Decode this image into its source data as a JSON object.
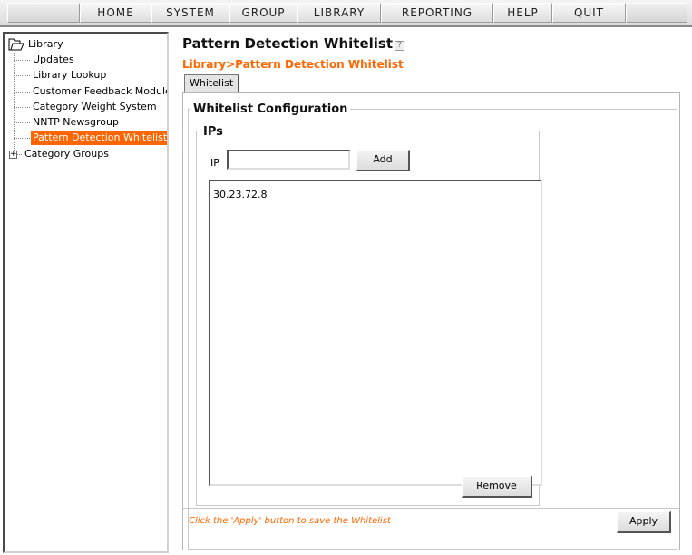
{
  "menu": {
    "items": [
      {
        "label": "HOME"
      },
      {
        "label": "SYSTEM"
      },
      {
        "label": "GROUP"
      },
      {
        "label": "LIBRARY"
      },
      {
        "label": "REPORTING"
      },
      {
        "label": "HELP"
      },
      {
        "label": "QUIT"
      }
    ]
  },
  "tree": {
    "root_label": "Library",
    "items": [
      {
        "label": "Updates"
      },
      {
        "label": "Library Lookup"
      },
      {
        "label": "Customer Feedback Module"
      },
      {
        "label": "Category Weight System"
      },
      {
        "label": "NNTP Newsgroup"
      },
      {
        "label": "Pattern Detection Whitelist",
        "selected": true
      },
      {
        "label": "Category Groups",
        "expandable": true
      }
    ]
  },
  "page": {
    "title": "Pattern Detection Whitelist",
    "help_icon": "?",
    "breadcrumb": "Library>Pattern Detection Whitelist",
    "tab": "Whitelist"
  },
  "config": {
    "legend": "Whitelist Configuration",
    "ips_legend": "IPs",
    "ip_label": "IP",
    "ip_value": "",
    "add_label": "Add",
    "ip_list": [
      "30.23.72.8"
    ],
    "remove_label": "Remove"
  },
  "footer": {
    "note": "Click the 'Apply' button to save the Whitelist",
    "apply_label": "Apply"
  },
  "colors": {
    "accent": "#ff6600",
    "selected_bg": "#ff6600"
  }
}
